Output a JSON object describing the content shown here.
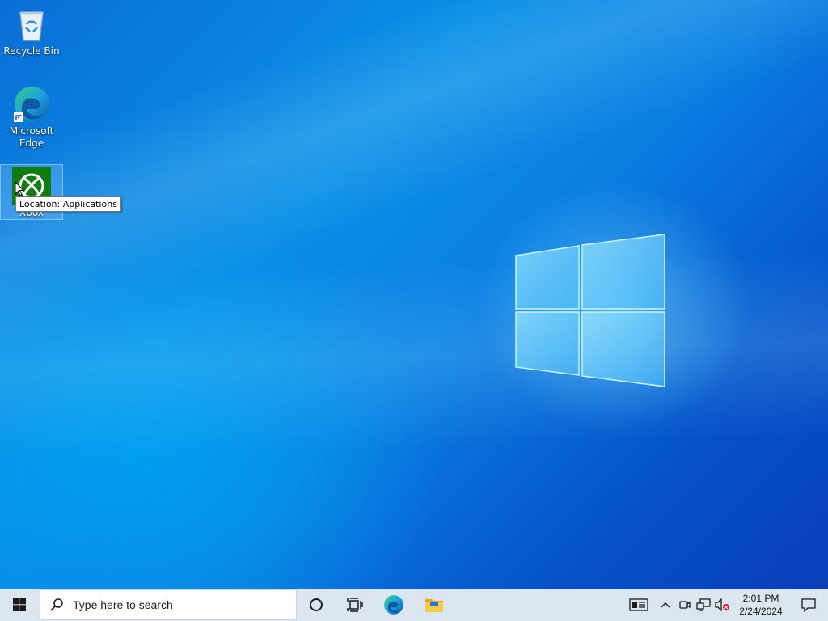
{
  "desktop": {
    "icons": [
      {
        "label": "Recycle Bin",
        "icon": "recycle-bin-icon"
      },
      {
        "label": "Microsoft Edge",
        "icon": "edge-icon"
      },
      {
        "label": "Xbox",
        "icon": "xbox-icon"
      }
    ],
    "tooltip": "Location: Applications"
  },
  "taskbar": {
    "search_placeholder": "Type here to search",
    "pinned": [
      "cortana-icon",
      "task-view-icon",
      "edge-icon",
      "file-explorer-icon"
    ],
    "tray_icons": [
      "news-icon",
      "chevron-up-icon",
      "meet-now-icon",
      "network-icon",
      "volume-muted-icon"
    ],
    "time": "2:01 PM",
    "date": "2/24/2024",
    "colors": {
      "taskbar": "#dce6f0",
      "accent": "#0078d7"
    }
  }
}
